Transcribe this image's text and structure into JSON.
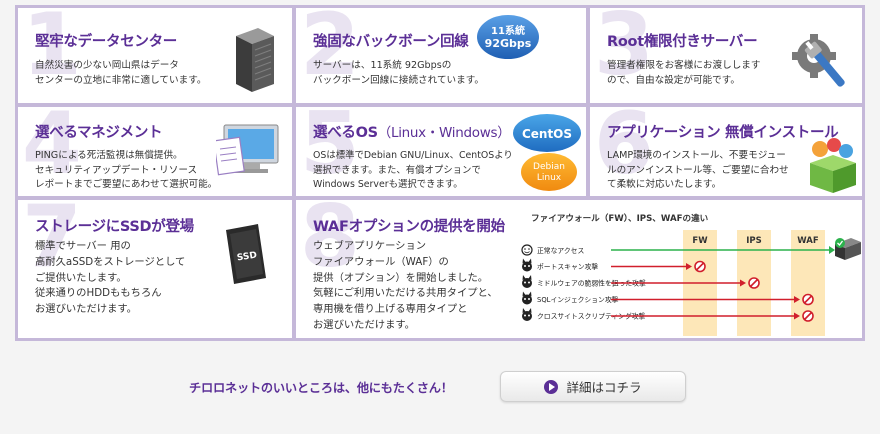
{
  "features": [
    {
      "num": "1",
      "title": "堅牢なデータセンター",
      "desc": "自然災害の少ない岡山県はデータ\nセンターの立地に非常に適しています。"
    },
    {
      "num": "2",
      "title": "強固なバックボーン回線",
      "desc": "サーバーは、11系統 92Gbpsの\nバックボーン回線に接続されています。",
      "badge_line1": "11系統",
      "badge_line2": "92Gbps"
    },
    {
      "num": "3",
      "title": "Root権限付きサーバー",
      "desc": "管理者権限をお客様にお渡しします\nので、自由な設定が可能です。"
    },
    {
      "num": "4",
      "title": "選べるマネジメント",
      "desc": "PINGによる死活監視は無償提供。\nセキュリティアップデート・リソース\nレポートまでご要望にあわせて選択可能。"
    },
    {
      "num": "5",
      "title": "選べるOS",
      "title_sub": "（Linux・Windows）",
      "desc": "OSは標準でDebian GNU/Linux、CentOSより\n選択できます。また、有償オプションで\nWindows Serverも選択できます。",
      "badge_centos": "CentOS",
      "badge_debian1": "Debian",
      "badge_debian2": "Linux"
    },
    {
      "num": "6",
      "title": "アプリケーション 無償インストール",
      "desc": "LAMP環境のインストール、不要モジュー\nルのアンインストール等、ご要望に合わせ\nて柔軟に対応いたします。"
    },
    {
      "num": "7",
      "title": "ストレージにSSDが登場",
      "desc": "標準でサーバー 用の\n高耐久aSSDをストレージとして\nご提供いたします。\n従来通りのHDDももちろん\nお選びいただけます。",
      "ssd_label": "SSD"
    },
    {
      "num": "8",
      "title": "WAFオプションの提供を開始",
      "desc": "ウェブアプリケーション\nファイアウォール（WAF）の\n提供（オプション）を開始しました。\n気軽にご利用いただける共用タイプと、\n専用機を借り上げる専用タイプと\nお選びいただけます。"
    }
  ],
  "waf_diagram": {
    "title": "ファイアウォール（FW）、IPS、WAFの違い",
    "columns": [
      "FW",
      "IPS",
      "WAF"
    ],
    "rows": [
      {
        "label": "正常なアクセス",
        "blocked_at": 3
      },
      {
        "label": "ポートスキャン攻撃",
        "blocked_at": 0
      },
      {
        "label": "ミドルウェアの脆弱性を狙った攻撃",
        "blocked_at": 1
      },
      {
        "label": "SQLインジェクション攻撃",
        "blocked_at": 2
      },
      {
        "label": "クロスサイトスクリプティング攻撃",
        "blocked_at": 2
      }
    ]
  },
  "bottom": {
    "text": "チロロネットのいいところは、他にもたくさん！",
    "button_label": "詳細はコチラ"
  },
  "colors": {
    "accent": "#5b2f96",
    "border": "#c5b8d9",
    "number": "#e9e3f1",
    "attack": "#d11f2c",
    "ok": "#2bb24c"
  }
}
